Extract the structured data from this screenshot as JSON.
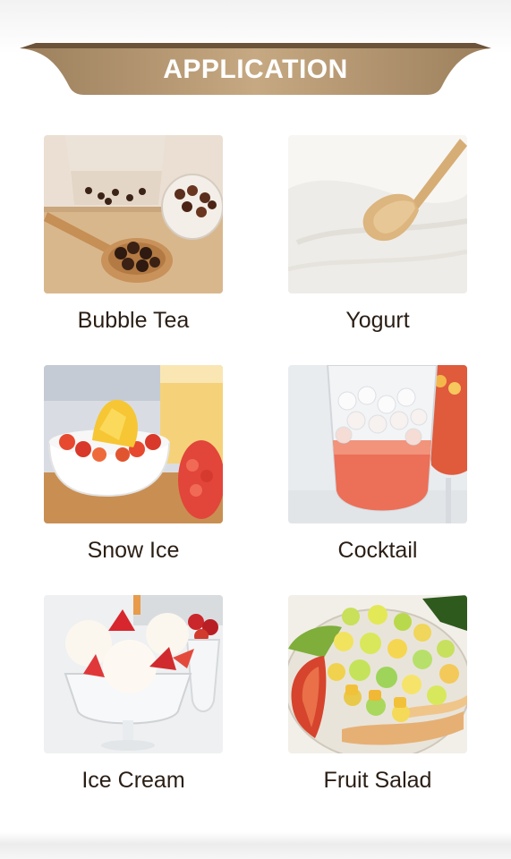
{
  "header": {
    "title": "APPLICATION",
    "ribbon_color": "#b89a72"
  },
  "items": [
    {
      "label": "Bubble Tea",
      "icon": "bubble-tea-photo"
    },
    {
      "label": "Yogurt",
      "icon": "yogurt-photo"
    },
    {
      "label": "Snow Ice",
      "icon": "snow-ice-photo"
    },
    {
      "label": "Cocktail",
      "icon": "cocktail-photo"
    },
    {
      "label": "Ice Cream",
      "icon": "ice-cream-photo"
    },
    {
      "label": "Fruit Salad",
      "icon": "fruit-salad-photo"
    }
  ]
}
